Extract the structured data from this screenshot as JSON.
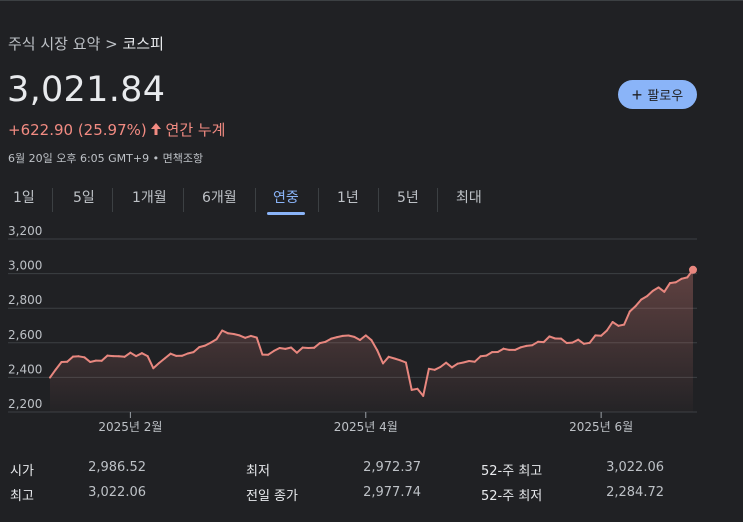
{
  "breadcrumb": {
    "prefix": "주식 시장 요약 >",
    "current": "코스피"
  },
  "price": "3,021.84",
  "change": {
    "text": "+622.90 (25.97%)",
    "arrow": "🡑",
    "period": "연간 누계"
  },
  "meta": "6월 20일 오후 6:05 GMT+9 • 면책조항",
  "follow_button": {
    "label": "팔로우",
    "icon": "plus-icon"
  },
  "tabs": [
    {
      "label": "1일",
      "active": false
    },
    {
      "label": "5일",
      "active": false
    },
    {
      "label": "1개월",
      "active": false
    },
    {
      "label": "6개월",
      "active": false
    },
    {
      "label": "연중",
      "active": true
    },
    {
      "label": "1년",
      "active": false
    },
    {
      "label": "5년",
      "active": false
    },
    {
      "label": "최대",
      "active": false
    }
  ],
  "colors": {
    "line": "#e8877f",
    "accent": "#8ab4f8",
    "negative": "#f28b82"
  },
  "chart_data": {
    "type": "area",
    "y_ticks": [
      "3,200",
      "3,000",
      "2,800",
      "2,600",
      "2,400",
      "2,200"
    ],
    "ylim": [
      2200,
      3200
    ],
    "x_tick_labels": [
      "2025년 2월",
      "2025년 4월",
      "2025년 6월"
    ],
    "x_tick_index": [
      14,
      55,
      96
    ],
    "grid": true,
    "values": [
      2399,
      2445,
      2489,
      2490,
      2520,
      2522,
      2516,
      2489,
      2497,
      2496,
      2526,
      2523,
      2522,
      2519,
      2543,
      2523,
      2540,
      2523,
      2453,
      2483,
      2510,
      2537,
      2524,
      2525,
      2538,
      2546,
      2575,
      2584,
      2601,
      2620,
      2671,
      2655,
      2651,
      2643,
      2629,
      2640,
      2630,
      2532,
      2531,
      2553,
      2570,
      2565,
      2573,
      2543,
      2572,
      2570,
      2571,
      2598,
      2606,
      2624,
      2633,
      2640,
      2642,
      2634,
      2616,
      2643,
      2615,
      2557,
      2481,
      2519,
      2509,
      2499,
      2486,
      2328,
      2334,
      2293,
      2450,
      2444,
      2460,
      2485,
      2458,
      2479,
      2486,
      2495,
      2491,
      2522,
      2526,
      2546,
      2547,
      2566,
      2559,
      2559,
      2574,
      2582,
      2586,
      2606,
      2604,
      2637,
      2625,
      2624,
      2599,
      2601,
      2618,
      2594,
      2600,
      2643,
      2641,
      2671,
      2720,
      2698,
      2705,
      2781,
      2812,
      2850,
      2870,
      2900,
      2920,
      2895,
      2945,
      2950,
      2970,
      2978,
      3022
    ]
  },
  "stats": [
    {
      "label": "시가",
      "value": "2,986.52"
    },
    {
      "label": "최저",
      "value": "2,972.37"
    },
    {
      "label": "52-주 최고",
      "value": "3,022.06"
    },
    {
      "label": "최고",
      "value": "3,022.06"
    },
    {
      "label": "전일 종가",
      "value": "2,977.74"
    },
    {
      "label": "52-주 최저",
      "value": "2,284.72"
    }
  ]
}
